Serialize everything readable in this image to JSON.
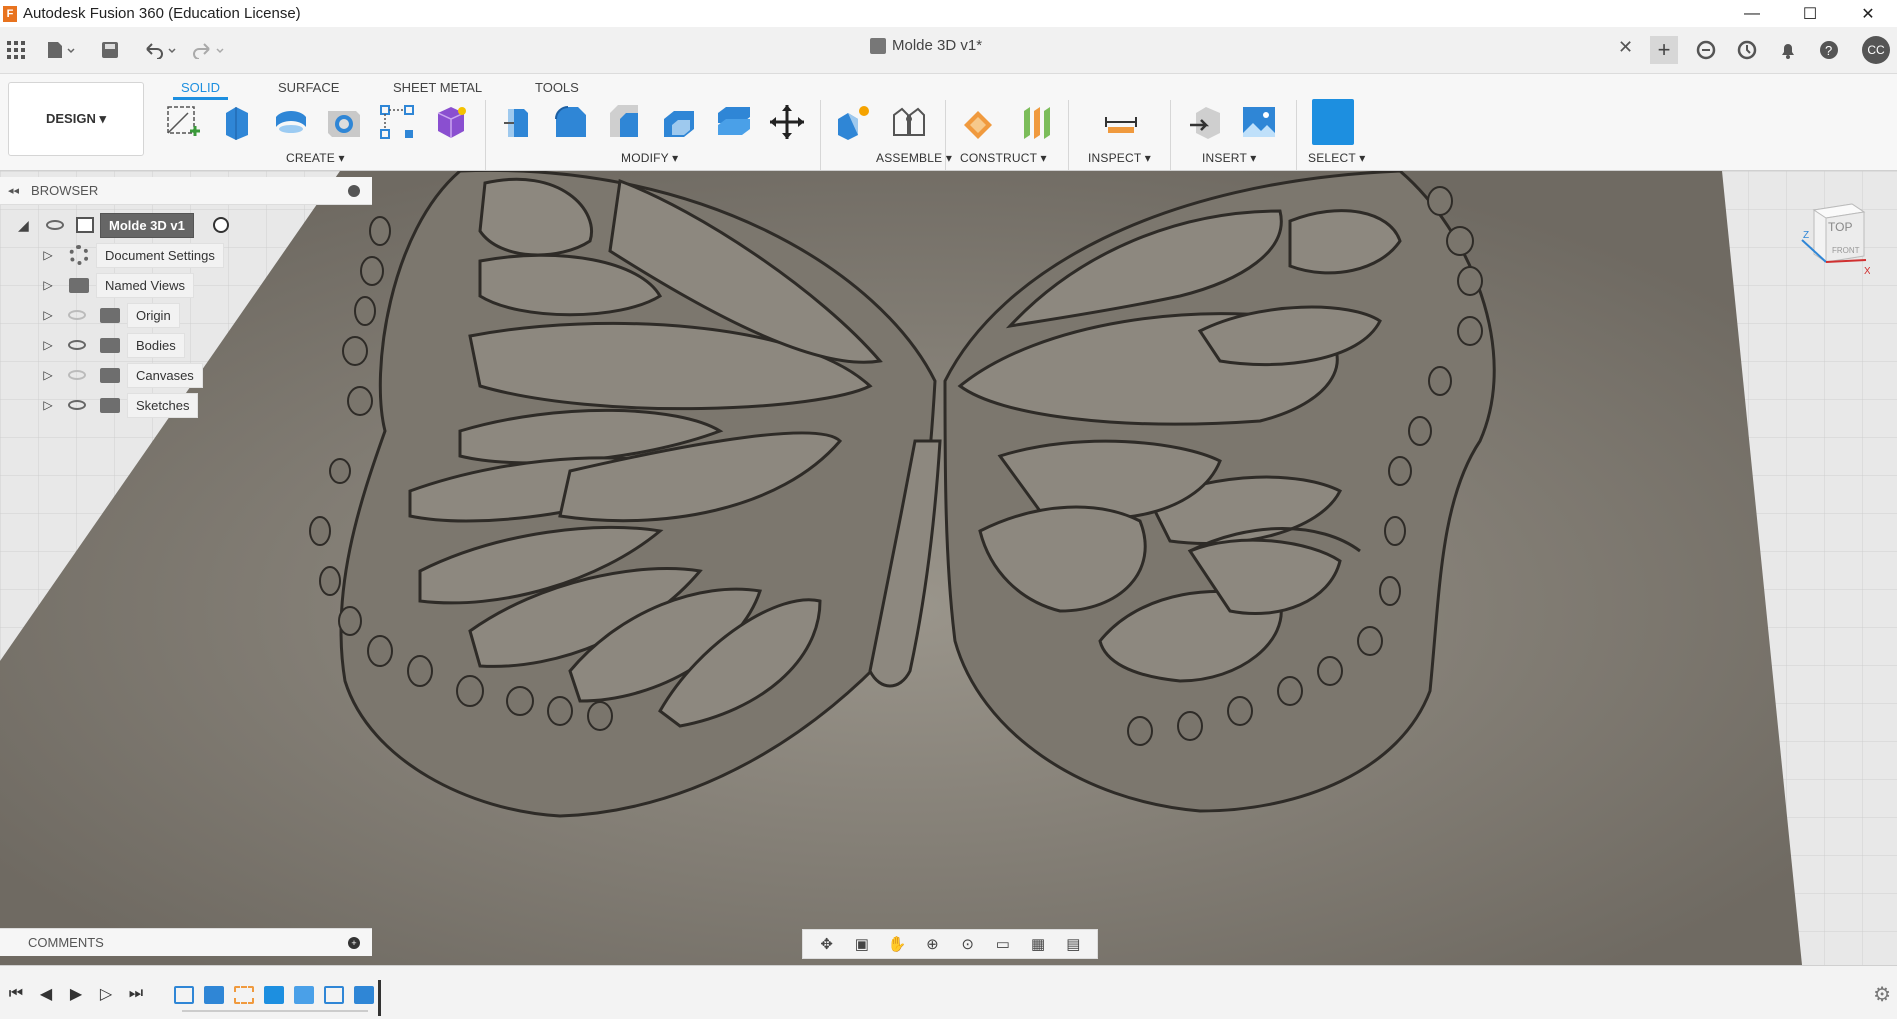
{
  "window": {
    "title": "Autodesk Fusion 360 (Education License)",
    "logo_letter": "F",
    "minimize": "—",
    "maximize": "☐",
    "close": "✕"
  },
  "document": {
    "tab_title": "Molde 3D v1*",
    "close": "✕",
    "user_initials": "CC"
  },
  "toolbar": {
    "workspace_label": "DESIGN ▾",
    "tabs": [
      "SOLID",
      "SURFACE",
      "SHEET METAL",
      "TOOLS"
    ],
    "groups": [
      "CREATE ▾",
      "MODIFY ▾",
      "ASSEMBLE ▾",
      "CONSTRUCT ▾",
      "INSPECT ▾",
      "INSERT ▾",
      "SELECT ▾"
    ]
  },
  "browser": {
    "title": "BROWSER",
    "items": [
      {
        "label": "Molde 3D v1"
      },
      {
        "label": "Document Settings"
      },
      {
        "label": "Named Views"
      },
      {
        "label": "Origin"
      },
      {
        "label": "Bodies"
      },
      {
        "label": "Canvases"
      },
      {
        "label": "Sketches"
      }
    ]
  },
  "viewcube": {
    "top": "TOP",
    "front": "FRONT"
  },
  "comments": {
    "title": "COMMENTS"
  },
  "colors": {
    "accent": "#1d8fe0",
    "model": "#8a857c",
    "model_dark": "#5a564f"
  }
}
